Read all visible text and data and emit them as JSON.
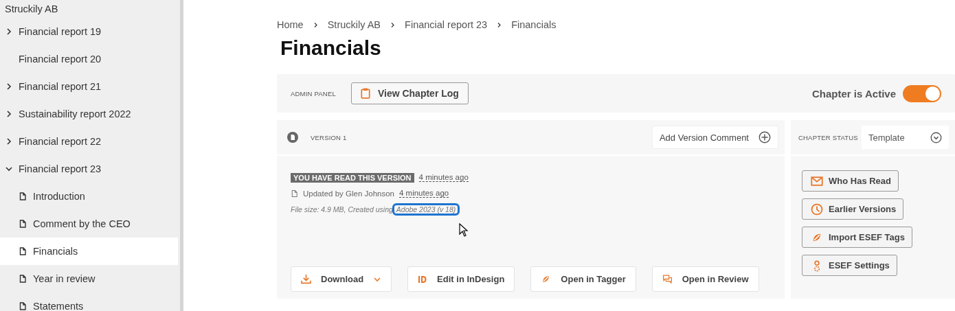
{
  "sidebar": {
    "root": "Struckily AB",
    "items": [
      {
        "label": "Financial report 19",
        "expandable": true,
        "expanded": false
      },
      {
        "label": "Financial report 20",
        "expandable": false
      },
      {
        "label": "Financial report 21",
        "expandable": true,
        "expanded": false
      },
      {
        "label": "Sustainability report 2022",
        "expandable": true,
        "expanded": false
      },
      {
        "label": "Financial report 22",
        "expandable": true,
        "expanded": false
      },
      {
        "label": "Financial report 23",
        "expandable": true,
        "expanded": true,
        "children": [
          {
            "label": "Introduction",
            "selected": false
          },
          {
            "label": "Comment by the CEO",
            "selected": false
          },
          {
            "label": "Financials",
            "selected": true
          },
          {
            "label": "Year in review",
            "selected": false
          },
          {
            "label": "Statements",
            "selected": false
          }
        ]
      }
    ]
  },
  "breadcrumb": [
    "Home",
    "Struckily AB",
    "Financial report 23",
    "Financials"
  ],
  "title": "Financials",
  "admin_panel": {
    "label": "ADMIN PANEL",
    "button": "View Chapter Log",
    "toggle_label": "Chapter is Active",
    "active": true
  },
  "version": {
    "label": "VERSION 1",
    "comment_button": "Add Version Comment",
    "read_badge": "YOU HAVE READ THIS VERSION",
    "read_time": "4 minutes ago",
    "updated_by": "Updated by Glen Johnson",
    "updated_time": "4 minutes ago",
    "file_info": "File size: 4.9 MB, Created using",
    "app_link": "Adobe 2023 (v 18)",
    "app_link_focused": true,
    "actions": [
      {
        "kind": "download",
        "label": "Download"
      },
      {
        "kind": "indesign",
        "label": "Edit in InDesign"
      },
      {
        "kind": "tagger",
        "label": "Open in Tagger"
      },
      {
        "kind": "review",
        "label": "Open in Review"
      }
    ]
  },
  "chapter_status": {
    "label": "CHAPTER STATUS",
    "value": "Template",
    "buttons": [
      {
        "kind": "mail",
        "label": "Who Has Read"
      },
      {
        "kind": "clock",
        "label": "Earlier Versions"
      },
      {
        "kind": "tagger",
        "label": "Import ESEF Tags"
      },
      {
        "kind": "settings",
        "label": "ESEF Settings"
      }
    ]
  }
}
